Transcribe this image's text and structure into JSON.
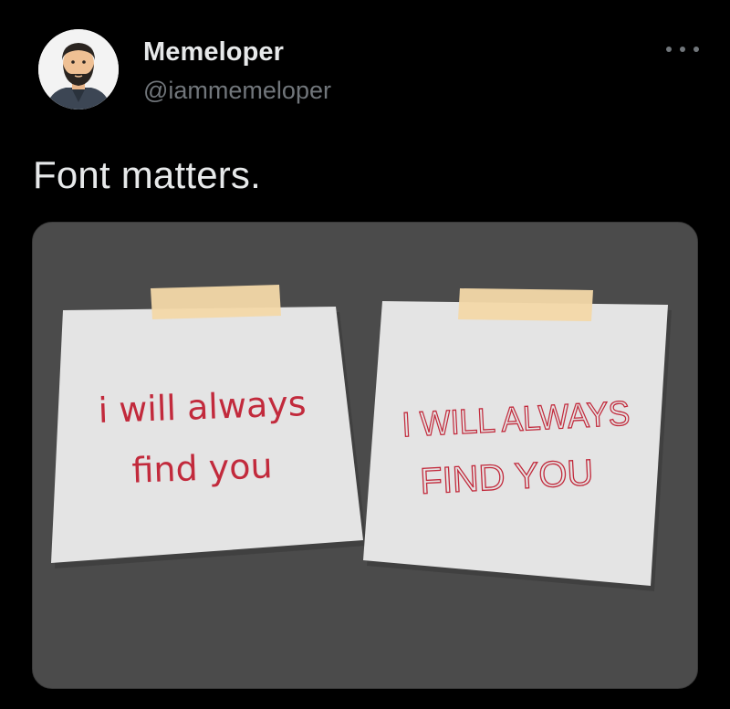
{
  "author": {
    "display_name": "Memeloper",
    "handle": "@iammemeloper",
    "avatar_icon": "bearded-man-avatar-icon"
  },
  "more_icon": "more-options-icon",
  "tweet": {
    "text": "Font matters."
  },
  "media": {
    "note_left": {
      "line1": "i will always",
      "line2": "find you"
    },
    "note_right": {
      "line1": "I WILL ALWAYS",
      "line2": "FIND YOU"
    },
    "colors": {
      "background": "#4b4b4b",
      "note": "#e4e4e4",
      "tape": "#f3d8a8",
      "ink": "#c22a3c"
    }
  }
}
